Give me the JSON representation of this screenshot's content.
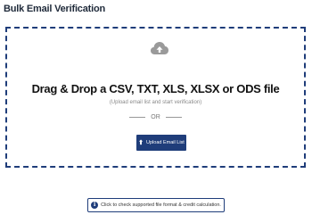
{
  "page": {
    "title": "Bulk Email Verification"
  },
  "dropzone": {
    "icon": "cloud-upload-icon",
    "heading": "Drag & Drop a CSV, TXT, XLS, XLSX or ODS file",
    "subtext": "(Upload email list and start verification)",
    "or_text": "OR",
    "upload_button": {
      "icon": "upload-arrow-icon",
      "label": "Upload Email List"
    }
  },
  "info": {
    "icon": "info-icon",
    "label": "Click to check supported file format & credit calculation."
  },
  "colors": {
    "accent": "#1f3d7a",
    "icon_gray": "#9a9a9a"
  }
}
